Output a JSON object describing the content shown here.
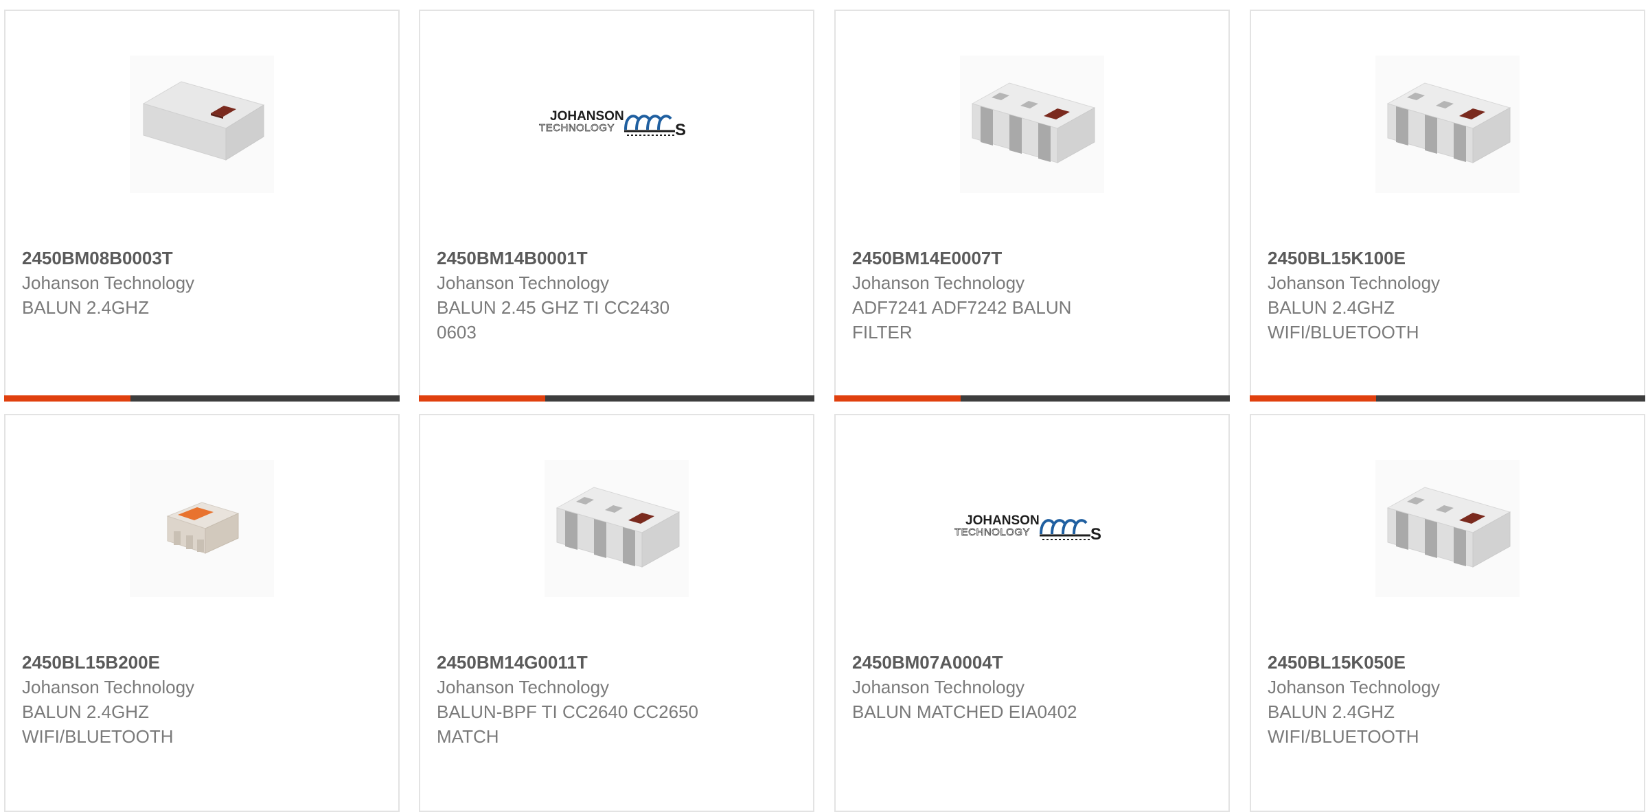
{
  "colors": {
    "accent": "#e0400e",
    "bar": "#3d3d3d",
    "border": "#e3e3e3",
    "text_strong": "#5a5a5a",
    "text_muted": "#7a7a7a"
  },
  "products": [
    {
      "part_number": "2450BM08B0003T",
      "manufacturer": "Johanson Technology",
      "description": "BALUN 2.4GHZ",
      "image": "chip-plain-icon",
      "show_bar": true,
      "bar_fraction": 0.32
    },
    {
      "part_number": "2450BM14B0001T",
      "manufacturer": "Johanson Technology",
      "description": "BALUN 2.45 GHZ TI CC2430\n0603",
      "image": "johanson-logo",
      "show_bar": true,
      "bar_fraction": 0.32
    },
    {
      "part_number": "2450BM14E0007T",
      "manufacturer": "Johanson Technology",
      "description": "ADF7241 ADF7242 BALUN\nFILTER",
      "image": "chip-terminals-icon",
      "show_bar": true,
      "bar_fraction": 0.32
    },
    {
      "part_number": "2450BL15K100E",
      "manufacturer": "Johanson Technology",
      "description": "BALUN 2.4GHZ\nWIFI/BLUETOOTH",
      "image": "chip-terminals-icon",
      "show_bar": true,
      "bar_fraction": 0.32
    },
    {
      "part_number": "2450BL15B200E",
      "manufacturer": "Johanson Technology",
      "description": "BALUN 2.4GHZ\nWIFI/BLUETOOTH",
      "image": "chip-orange-icon",
      "show_bar": false,
      "bar_fraction": 0
    },
    {
      "part_number": "2450BM14G0011T",
      "manufacturer": "Johanson Technology",
      "description": "BALUN-BPF TI CC2640 CC2650\nMATCH",
      "image": "chip-terminals-icon",
      "show_bar": false,
      "bar_fraction": 0
    },
    {
      "part_number": "2450BM07A0004T",
      "manufacturer": "Johanson Technology",
      "description": "BALUN MATCHED EIA0402",
      "image": "johanson-logo",
      "show_bar": false,
      "bar_fraction": 0
    },
    {
      "part_number": "2450BL15K050E",
      "manufacturer": "Johanson Technology",
      "description": "BALUN 2.4GHZ\nWIFI/BLUETOOTH",
      "image": "chip-terminals-icon",
      "show_bar": false,
      "bar_fraction": 0
    }
  ]
}
